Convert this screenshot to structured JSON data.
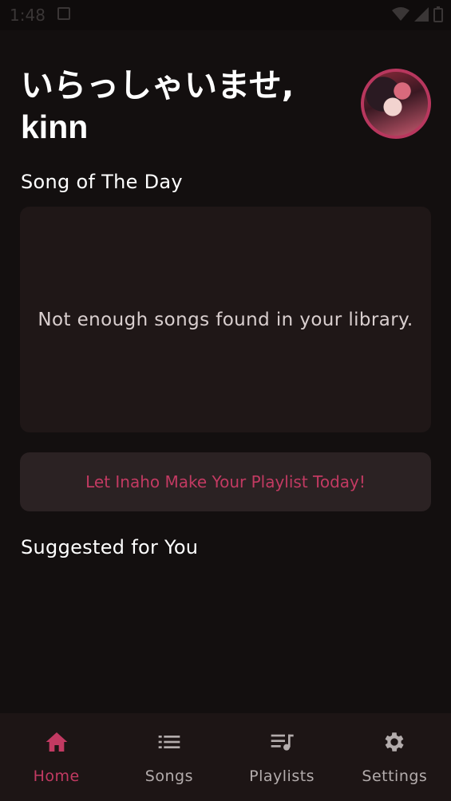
{
  "status_bar": {
    "time": "1:48"
  },
  "header": {
    "greeting": "いらっしゃいませ,",
    "username": "kinn"
  },
  "song_of_the_day": {
    "title": "Song of The Day",
    "empty_message": "Not enough songs found in your library."
  },
  "playlist_cta": {
    "label": "Let Inaho Make Your Playlist Today!"
  },
  "suggested": {
    "title": "Suggested for You"
  },
  "bottom_nav": {
    "items": [
      {
        "label": "Home",
        "icon": "home-icon",
        "active": true
      },
      {
        "label": "Songs",
        "icon": "list-icon",
        "active": false
      },
      {
        "label": "Playlists",
        "icon": "playlist-icon",
        "active": false
      },
      {
        "label": "Settings",
        "icon": "gear-icon",
        "active": false
      }
    ]
  },
  "colors": {
    "background": "#130f0f",
    "card": "#1f1717",
    "accent": "#c23a62",
    "nav_background": "#1d1515"
  }
}
